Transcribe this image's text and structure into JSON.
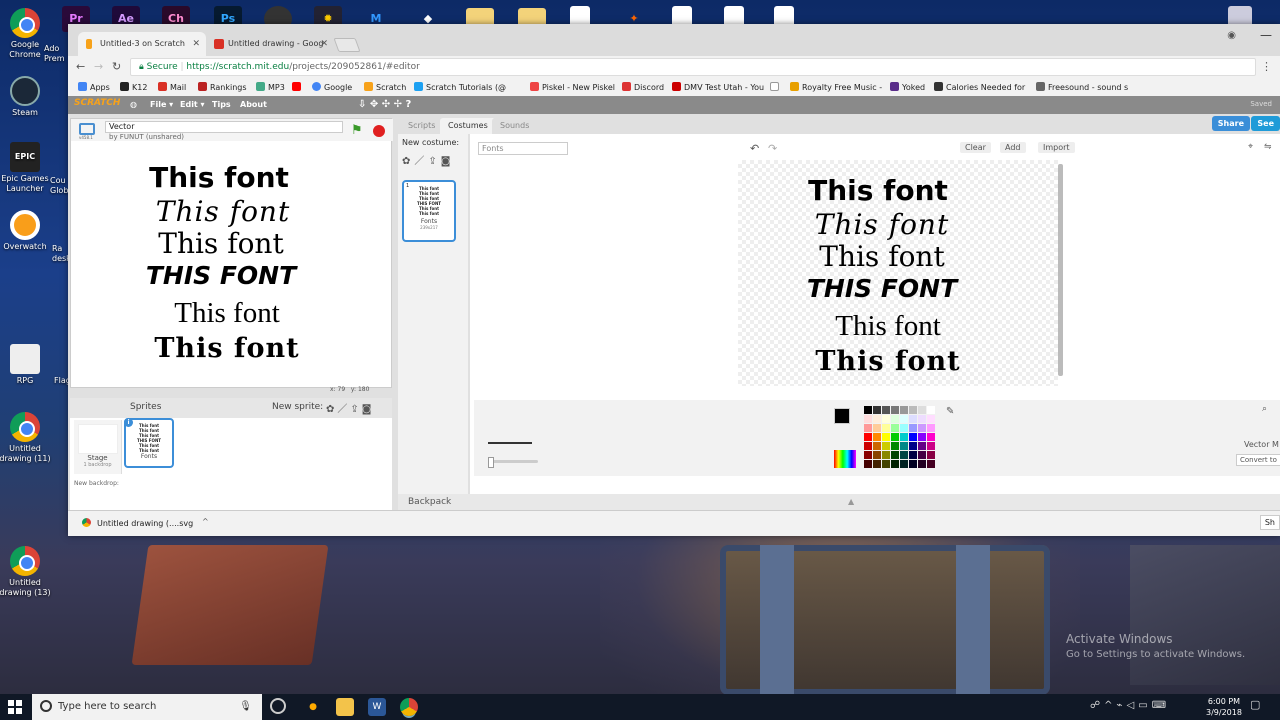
{
  "desktop": {
    "icons": [
      {
        "label": "Google Chrome",
        "type": "chrome"
      },
      {
        "label": "Steam",
        "type": "steam"
      },
      {
        "label": "Epic Games Launcher",
        "type": "epic"
      },
      {
        "label": "Overwatch",
        "type": "overwatch"
      },
      {
        "label": "RPG",
        "type": "rpg"
      },
      {
        "label": "Untitled drawing (11)",
        "type": "chrome"
      },
      {
        "label": "Untitled drawing (13)",
        "type": "chrome"
      }
    ],
    "partial_labels": [
      "Ado Prem",
      "Cou Glob",
      "Ra desk",
      "Flag"
    ],
    "epic_icon_text": "EPIC",
    "top_apps": [
      "Pr",
      "Ae",
      "Ch",
      "Ps"
    ],
    "activate": {
      "title": "Activate Windows",
      "subtitle": "Go to Settings to activate Windows."
    }
  },
  "browser": {
    "tabs": [
      {
        "title": "Untitled-3 on Scratch",
        "active": true
      },
      {
        "title": "Untitled drawing - Goog",
        "active": false
      }
    ],
    "secure_label": "Secure",
    "url_host": "https://scratch.mit.edu",
    "url_path": "/projects/209052861/#editor",
    "bookmarks": [
      "Apps",
      "K12",
      "Mail",
      "Rankings",
      "MP3",
      "Google",
      "Scratch",
      "Scratch Tutorials (@",
      "Piskel - New Piskel",
      "Discord",
      "DMV Test Utah - You",
      "Royalty Free Music -",
      "Yoked",
      "Calories Needed for",
      "Freesound - sound s"
    ]
  },
  "scratch": {
    "logo": "SCRATCH",
    "menu": [
      "File ▾",
      "Edit ▾",
      "Tips",
      "About"
    ],
    "saved": "Saved",
    "share": "Share",
    "see_project": "See",
    "project_title": "Vector",
    "author": "by FUNUT (unshared)",
    "version": "v458.1",
    "stage_lines": [
      "This font",
      "This font",
      "This font",
      "THIS FONT",
      "This font",
      "This font"
    ],
    "coords": {
      "x_label": "x:",
      "x": "79",
      "y_label": "y:",
      "y": "180"
    },
    "sprites_label": "Sprites",
    "new_sprite_label": "New sprite:",
    "stage_label": "Stage",
    "stage_backdrops": "1 backdrop",
    "new_backdrop_label": "New backdrop:",
    "sprite_name": "Fonts",
    "tabs": [
      "Scripts",
      "Costumes",
      "Sounds"
    ],
    "new_costume_label": "New costume:",
    "costume": {
      "index": "1",
      "name": "Fonts",
      "size": "239x217"
    },
    "costume_name_value": "Fonts",
    "editor_buttons": [
      "Clear",
      "Add",
      "Import"
    ],
    "canvas_lines": [
      "This font",
      "This font",
      "This font",
      "THIS FONT",
      "This font",
      "This font"
    ],
    "vector_mode": "Vector M",
    "convert_btn": "Convert to",
    "backpack": "Backpack"
  },
  "download": {
    "file": "Untitled drawing (....svg",
    "show_all": "Sh"
  },
  "taskbar": {
    "search_placeholder": "Type here to search",
    "time": "6:00 PM",
    "date": "3/9/2018"
  },
  "colors": {
    "scratch_menu": "#8a8a8a",
    "selection_blue": "#3c8ed8",
    "share_blue": "#3a8ed8"
  }
}
